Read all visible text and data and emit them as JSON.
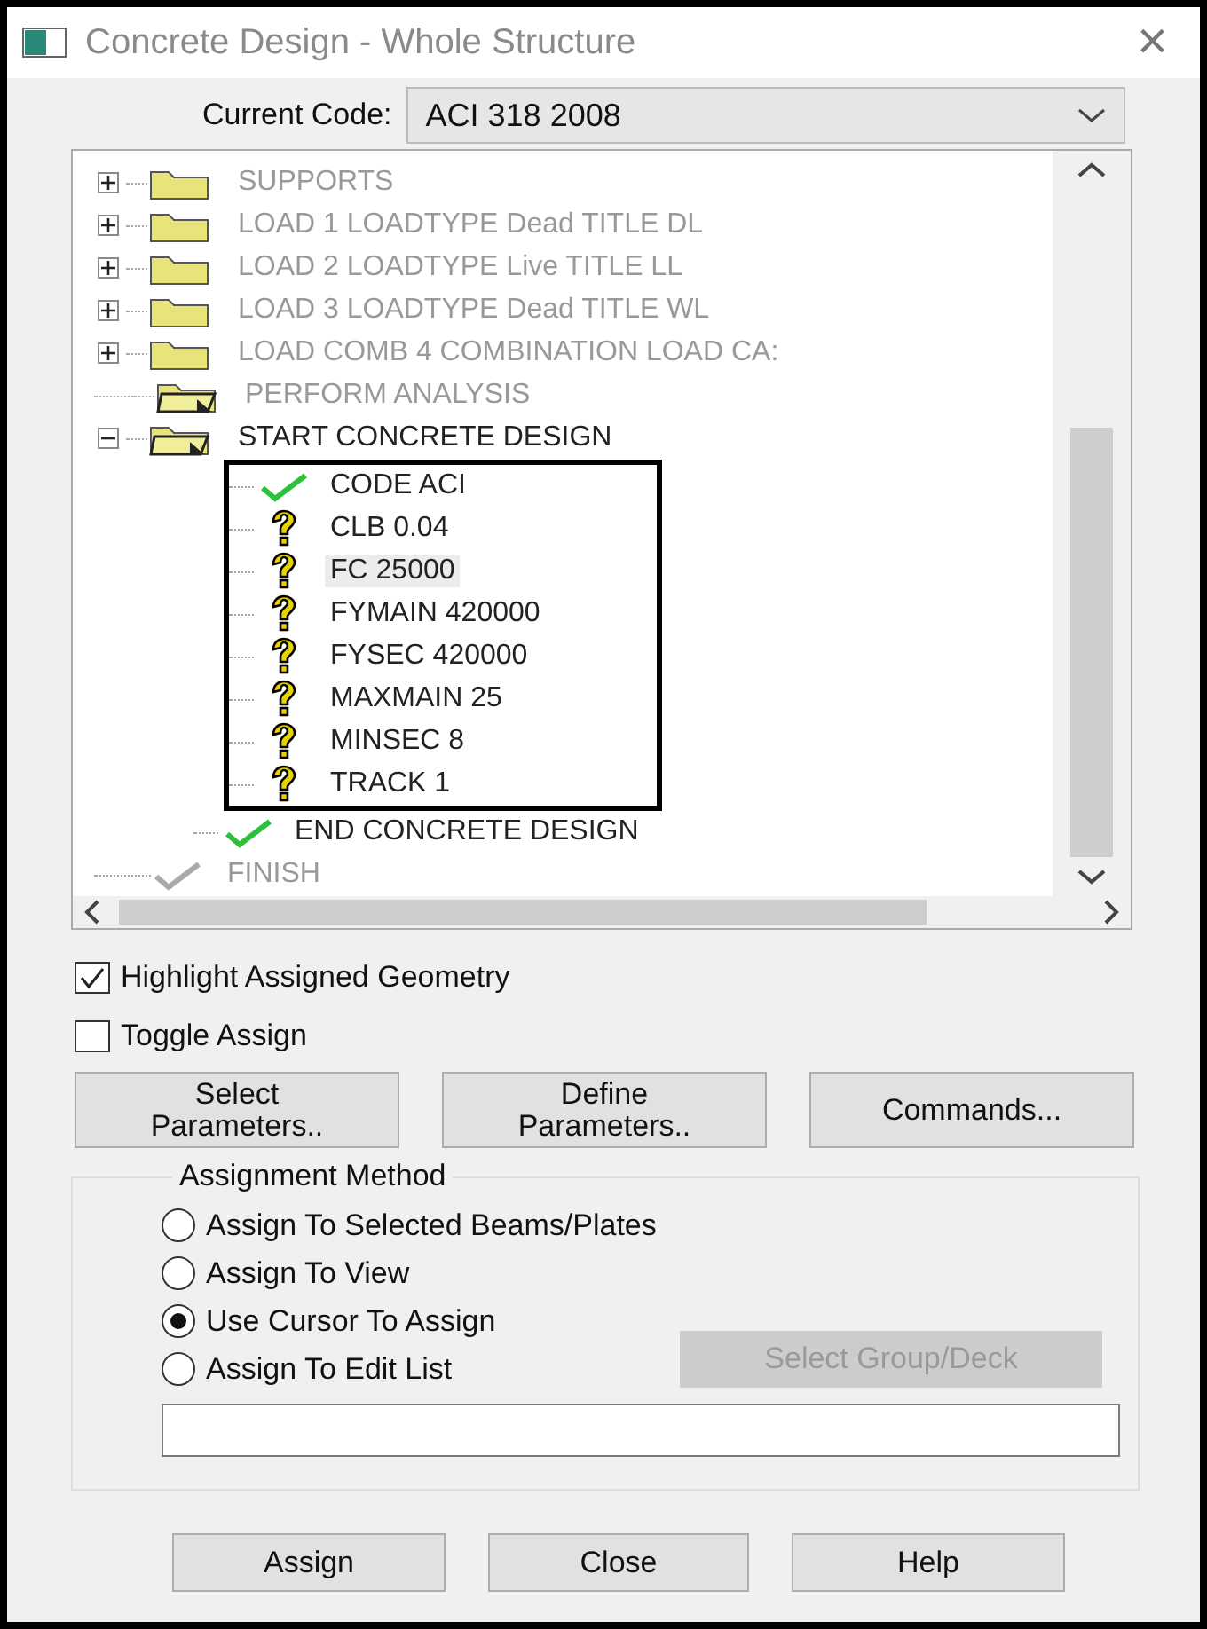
{
  "window": {
    "title": "Concrete Design - Whole Structure",
    "close": "×"
  },
  "current_code": {
    "label": "Current Code:",
    "value": "ACI 318 2008"
  },
  "tree": [
    {
      "label": "SUPPORTS",
      "kind": "folder",
      "expanded": false,
      "dimmed": true
    },
    {
      "label": "LOAD 1 LOADTYPE Dead  TITLE DL",
      "kind": "folder",
      "expanded": false,
      "dimmed": true
    },
    {
      "label": "LOAD 2 LOADTYPE Live  TITLE LL",
      "kind": "folder",
      "expanded": false,
      "dimmed": true
    },
    {
      "label": "LOAD 3 LOADTYPE Dead  TITLE WL",
      "kind": "folder",
      "expanded": false,
      "dimmed": true
    },
    {
      "label": "LOAD COMB 4 COMBINATION LOAD CA:",
      "kind": "folder",
      "expanded": false,
      "dimmed": true
    },
    {
      "label": "PERFORM ANALYSIS",
      "kind": "open-folder",
      "dimmed": true
    },
    {
      "label": "START CONCRETE DESIGN",
      "kind": "folder",
      "expanded": true,
      "dimmed": false,
      "children": [
        {
          "label": "CODE ACI",
          "kind": "check",
          "framed": true,
          "selected": false
        },
        {
          "label": "CLB 0.04",
          "kind": "question",
          "framed": true,
          "selected": false
        },
        {
          "label": "FC 25000",
          "kind": "question",
          "framed": true,
          "selected": true
        },
        {
          "label": "FYMAIN 420000",
          "kind": "question",
          "framed": true,
          "selected": false
        },
        {
          "label": "FYSEC 420000",
          "kind": "question",
          "framed": true,
          "selected": false
        },
        {
          "label": "MAXMAIN 25",
          "kind": "question",
          "framed": true,
          "selected": false
        },
        {
          "label": "MINSEC 8",
          "kind": "question",
          "framed": true,
          "selected": false
        },
        {
          "label": "TRACK 1",
          "kind": "question",
          "framed": true,
          "selected": false
        },
        {
          "label": "END CONCRETE DESIGN",
          "kind": "check",
          "framed": false,
          "selected": false
        }
      ]
    },
    {
      "label": "FINISH",
      "kind": "check",
      "dimmed": true
    }
  ],
  "checkboxes": [
    {
      "label": "Highlight Assigned Geometry",
      "checked": true
    },
    {
      "label": "Toggle Assign",
      "checked": false
    }
  ],
  "action_buttons": [
    [
      "Select",
      "Parameters.."
    ],
    [
      "Define",
      "Parameters.."
    ],
    [
      "Commands..."
    ]
  ],
  "assignment_method": {
    "title": "Assignment Method",
    "options": [
      {
        "label": "Assign To Selected Beams/Plates",
        "selected": false
      },
      {
        "label": "Assign To View",
        "selected": false
      },
      {
        "label": "Use Cursor To Assign",
        "selected": true
      },
      {
        "label": "Assign To Edit List",
        "selected": false
      }
    ],
    "group_button": {
      "label": "Select Group/Deck",
      "disabled": true
    }
  },
  "footer_buttons": [
    "Assign",
    "Close",
    "Help"
  ]
}
